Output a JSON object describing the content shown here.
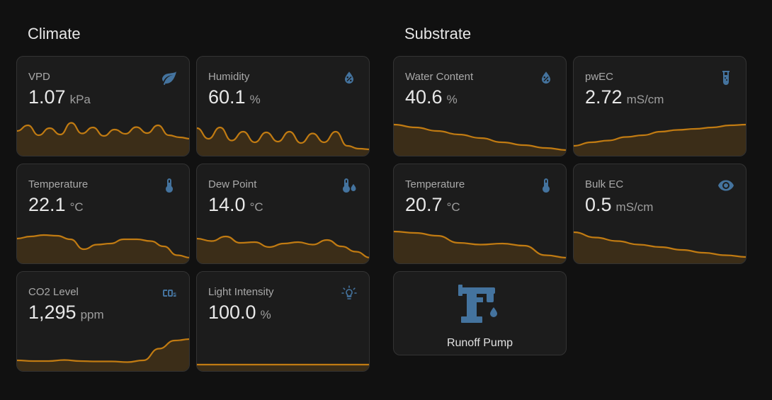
{
  "sections": {
    "climate": {
      "title": "Climate"
    },
    "substrate": {
      "title": "Substrate"
    }
  },
  "colors": {
    "accent": "#ff9800",
    "line": "#c17b12",
    "fill": "#3b2d18",
    "icon": "#44739e",
    "card": "#1c1c1c"
  },
  "sensors": {
    "vpd": {
      "name": "VPD",
      "value": "1.07",
      "unit": "kPa",
      "icon": "leaf-icon",
      "trend": [
        0.62,
        0.78,
        0.5,
        0.7,
        0.52,
        0.85,
        0.55,
        0.72,
        0.48,
        0.66,
        0.54,
        0.73,
        0.56,
        0.78,
        0.5,
        0.44,
        0.4
      ]
    },
    "humidity": {
      "name": "Humidity",
      "value": "60.1",
      "unit": "%",
      "icon": "water-percent-icon",
      "trend": [
        0.7,
        0.4,
        0.72,
        0.35,
        0.6,
        0.3,
        0.58,
        0.32,
        0.6,
        0.28,
        0.55,
        0.3,
        0.6,
        0.2,
        0.12,
        0.1
      ]
    },
    "climate_temperature": {
      "name": "Temperature",
      "value": "22.1",
      "unit": "°C",
      "icon": "thermometer-icon",
      "trend": [
        0.62,
        0.68,
        0.72,
        0.7,
        0.6,
        0.32,
        0.45,
        0.48,
        0.6,
        0.6,
        0.55,
        0.4,
        0.15,
        0.08
      ]
    },
    "dew_point": {
      "name": "Dew Point",
      "value": "14.0",
      "unit": "°C",
      "icon": "thermometer-water-icon",
      "trend": [
        0.62,
        0.55,
        0.68,
        0.5,
        0.52,
        0.38,
        0.48,
        0.52,
        0.45,
        0.58,
        0.4,
        0.25,
        0.08
      ]
    },
    "co2": {
      "name": "CO2 Level",
      "value": "1,295",
      "unit": "ppm",
      "icon": "molecule-co2-icon",
      "trend": [
        0.22,
        0.2,
        0.2,
        0.23,
        0.2,
        0.19,
        0.19,
        0.17,
        0.22,
        0.55,
        0.78,
        0.82
      ]
    },
    "light": {
      "name": "Light Intensity",
      "value": "100.0",
      "unit": "%",
      "icon": "lightbulb-on-icon",
      "trend": [
        0.1,
        0.1,
        0.1,
        0.1
      ]
    },
    "water_content": {
      "name": "Water Content",
      "value": "40.6",
      "unit": "%",
      "icon": "water-percent-icon",
      "trend": [
        0.8,
        0.72,
        0.62,
        0.52,
        0.42,
        0.3,
        0.22,
        0.14,
        0.08
      ]
    },
    "pwec": {
      "name": "pwEC",
      "value": "2.72",
      "unit": "mS/cm",
      "icon": "test-tube-icon",
      "trend": [
        0.2,
        0.3,
        0.35,
        0.45,
        0.5,
        0.6,
        0.65,
        0.68,
        0.72,
        0.78,
        0.8
      ]
    },
    "substrate_temperature": {
      "name": "Temperature",
      "value": "20.7",
      "unit": "°C",
      "icon": "thermometer-icon",
      "trend": [
        0.82,
        0.78,
        0.7,
        0.5,
        0.45,
        0.48,
        0.42,
        0.15,
        0.08
      ]
    },
    "bulk_ec": {
      "name": "Bulk EC",
      "value": "0.5",
      "unit": "mS/cm",
      "icon": "eye-icon",
      "trend": [
        0.8,
        0.65,
        0.55,
        0.45,
        0.38,
        0.3,
        0.22,
        0.15,
        0.1
      ]
    }
  },
  "buttons": {
    "runoff_pump": {
      "name": "Runoff Pump",
      "icon": "water-pump-icon"
    }
  }
}
